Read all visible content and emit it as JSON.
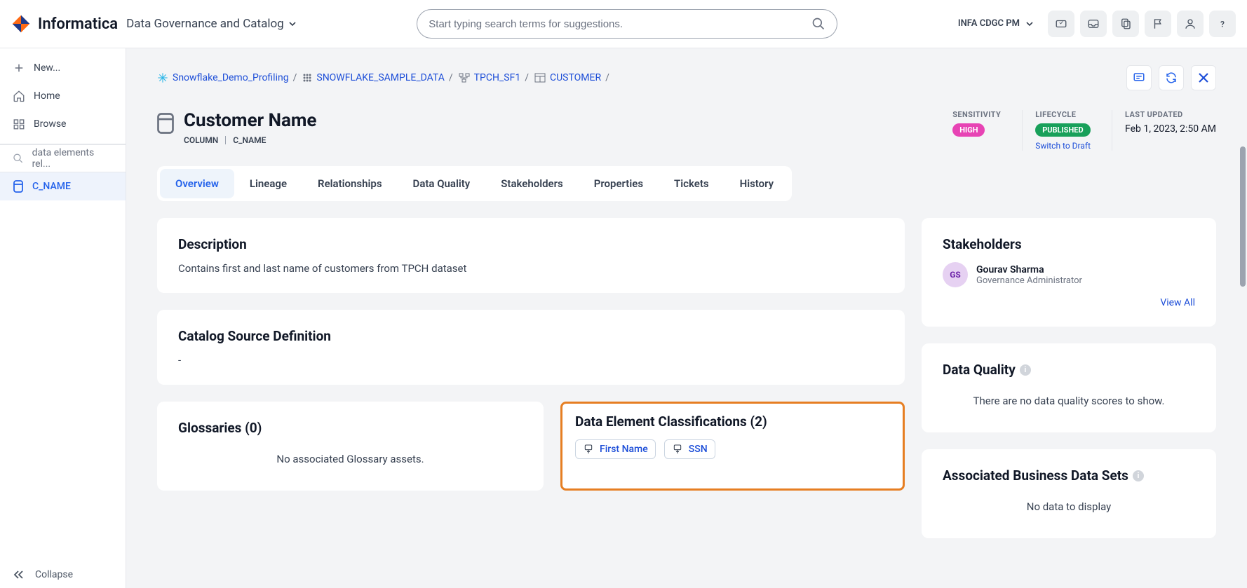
{
  "header": {
    "brand": "Informatica",
    "product": "Data Governance and Catalog",
    "search_placeholder": "Start typing search terms for suggestions.",
    "org": "INFA CDGC PM"
  },
  "sidebar": {
    "new": "New...",
    "home": "Home",
    "browse": "Browse",
    "search_text": "data elements rel...",
    "active_item": "C_NAME",
    "collapse": "Collapse"
  },
  "breadcrumbs": {
    "b0": "Snowflake_Demo_Profiling",
    "b1": "SNOWFLAKE_SAMPLE_DATA",
    "b2": "TPCH_SF1",
    "b3": "CUSTOMER"
  },
  "page": {
    "title": "Customer Name",
    "type": "COLUMN",
    "code": "C_NAME"
  },
  "meta": {
    "sens_label": "SENSITIVITY",
    "sens_value": "HIGH",
    "life_label": "LIFECYCLE",
    "life_value": "PUBLISHED",
    "life_link": "Switch to Draft",
    "upd_label": "LAST UPDATED",
    "upd_value": "Feb 1, 2023, 2:50 AM"
  },
  "tabs": {
    "t0": "Overview",
    "t1": "Lineage",
    "t2": "Relationships",
    "t3": "Data Quality",
    "t4": "Stakeholders",
    "t5": "Properties",
    "t6": "Tickets",
    "t7": "History"
  },
  "desc": {
    "title": "Description",
    "body": "Contains first and last name of customers from TPCH dataset"
  },
  "catalog": {
    "title": "Catalog Source Definition",
    "body": "-"
  },
  "gloss": {
    "title": "Glossaries (0)",
    "body": "No associated Glossary assets."
  },
  "classif": {
    "title": "Data Element Classifications (2)",
    "chip0": "First Name",
    "chip1": "SSN"
  },
  "stake": {
    "title": "Stakeholders",
    "initials": "GS",
    "name": "Gourav Sharma",
    "role": "Governance Administrator",
    "view_all": "View All"
  },
  "dq": {
    "title": "Data Quality",
    "body": "There are no data quality scores to show."
  },
  "abds": {
    "title": "Associated Business Data Sets",
    "body": "No data to display"
  }
}
